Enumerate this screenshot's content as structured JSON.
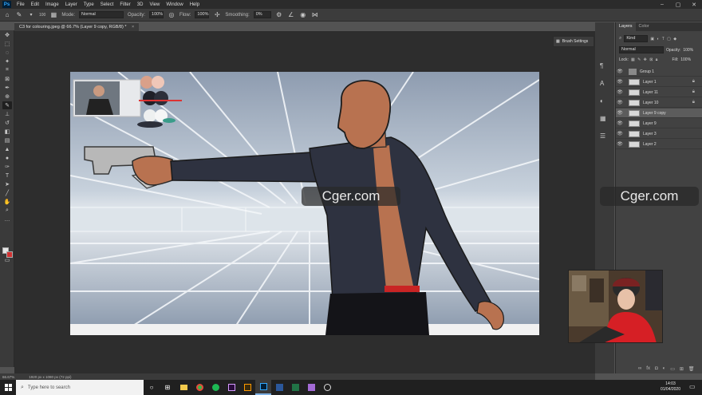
{
  "app": {
    "logo": "Ps"
  },
  "menu": [
    "File",
    "Edit",
    "Image",
    "Layer",
    "Type",
    "Select",
    "Filter",
    "3D",
    "View",
    "Window",
    "Help"
  ],
  "window_controls": [
    "minimize-icon",
    "maximize-icon",
    "close-icon"
  ],
  "options": {
    "brush_size": "100",
    "mode_label": "Mode:",
    "mode_value": "Normal",
    "opacity_label": "Opacity:",
    "opacity_value": "100%",
    "flow_label": "Flow:",
    "flow_value": "100%",
    "smoothing_label": "Smoothing:",
    "smoothing_value": "0%"
  },
  "document_tab": {
    "title": "C3 for colouring.jpeg @ 66.7% (Layer 9 copy, RGB/8) *",
    "close": "×"
  },
  "brush_settings": {
    "label": "Brush Settings"
  },
  "layers_panel": {
    "tabs": [
      "Layers",
      "Color"
    ],
    "filter_kind": "Kind",
    "blend_mode": "Normal",
    "opacity_label": "Opacity:",
    "opacity_value": "100%",
    "lock_label": "Lock:",
    "fill_label": "Fill:",
    "fill_value": "100%",
    "layers": [
      {
        "name": "Group 1",
        "type": "group",
        "locked": false,
        "selected": false
      },
      {
        "name": "Layer 1",
        "type": "layer",
        "locked": true,
        "selected": false
      },
      {
        "name": "Layer 11",
        "type": "layer",
        "locked": true,
        "selected": false
      },
      {
        "name": "Layer 10",
        "type": "layer",
        "locked": true,
        "selected": false
      },
      {
        "name": "Layer 9 copy",
        "type": "layer",
        "locked": false,
        "selected": true
      },
      {
        "name": "Layer 9",
        "type": "layer",
        "locked": false,
        "selected": false
      },
      {
        "name": "Layer 3",
        "type": "layer",
        "locked": false,
        "selected": false
      },
      {
        "name": "Layer 2",
        "type": "layer",
        "locked": false,
        "selected": false
      }
    ]
  },
  "status": {
    "zoom": "66.67%",
    "doc_size": "1920 px x 1080 px (72 ppi)"
  },
  "watermark": "Cger.com",
  "taskbar": {
    "search_placeholder": "Type here to search",
    "apps": [
      "task-view-icon",
      "file-explorer-icon",
      "edge-icon",
      "chrome-icon",
      "spotify-icon",
      "premiere-icon",
      "illustrator-icon",
      "photoshop-icon",
      "word-icon",
      "excel-icon",
      "media-icon",
      "obs-icon"
    ],
    "time": "14:03",
    "date": "01/04/2020"
  },
  "colors": {
    "accent": "#31a8ff",
    "canvas_bg": "#2d2d2d",
    "panel_bg": "#424242"
  }
}
